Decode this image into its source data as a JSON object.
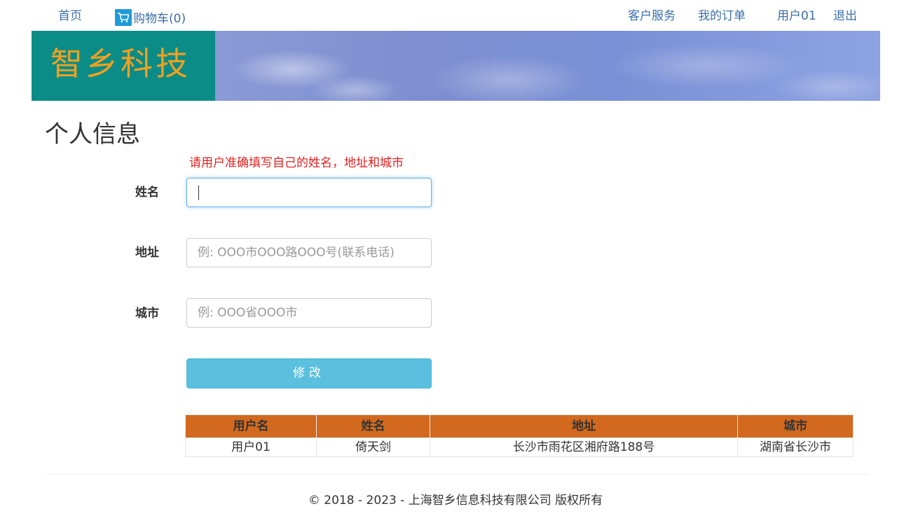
{
  "nav": {
    "home": "首页",
    "cart": "购物车(0)",
    "customer_service": "客户服务",
    "my_orders": "我的订单",
    "user": "用户01",
    "logout": "退出"
  },
  "banner": {
    "logo_text": "智乡科技"
  },
  "page": {
    "title": "个人信息",
    "hint": "请用户准确填写自己的姓名，地址和城市"
  },
  "form": {
    "name_label": "姓名",
    "name_value": "",
    "address_label": "地址",
    "address_placeholder": "例: OOO市OOO路OOO号(联系电话)",
    "city_label": "城市",
    "city_placeholder": "例: OOO省OOO市",
    "submit_label": "修改"
  },
  "table": {
    "headers": [
      "用户名",
      "姓名",
      "地址",
      "城市"
    ],
    "rows": [
      [
        "用户01",
        "倚天剑",
        "长沙市雨花区湘府路188号",
        "湖南省长沙市"
      ]
    ]
  },
  "footer": {
    "text": "© 2018 - 2023 - 上海智乡信息科技有限公司 版权所有"
  },
  "colors": {
    "link": "#3a6ea8",
    "logo_bg": "#0b8c86",
    "logo_text": "#f0a020",
    "hint": "#e32020",
    "button": "#5bc0de",
    "table_header": "#d2691e"
  },
  "icons": {
    "cart": "shopping-cart-icon"
  }
}
